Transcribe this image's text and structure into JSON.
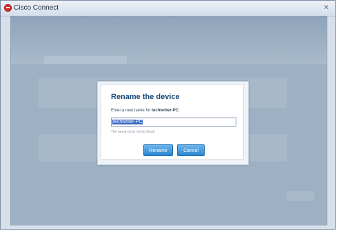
{
  "window": {
    "title": "Cisco Connect"
  },
  "dialog": {
    "title": "Rename the device",
    "prompt": "Enter a new name for ",
    "device_name": "techwriter-PC",
    "prompt_suffix": ":",
    "input_value": "techwriter-PC",
    "hint": "The name must not be blank",
    "rename_label": "Rename",
    "cancel_label": "Cancel"
  },
  "colors": {
    "accent": "#2d85cf",
    "title": "#1a4b78",
    "selection": "#3665c5"
  },
  "icons": {
    "app": "cisco-logo-icon",
    "close": "close-icon"
  }
}
